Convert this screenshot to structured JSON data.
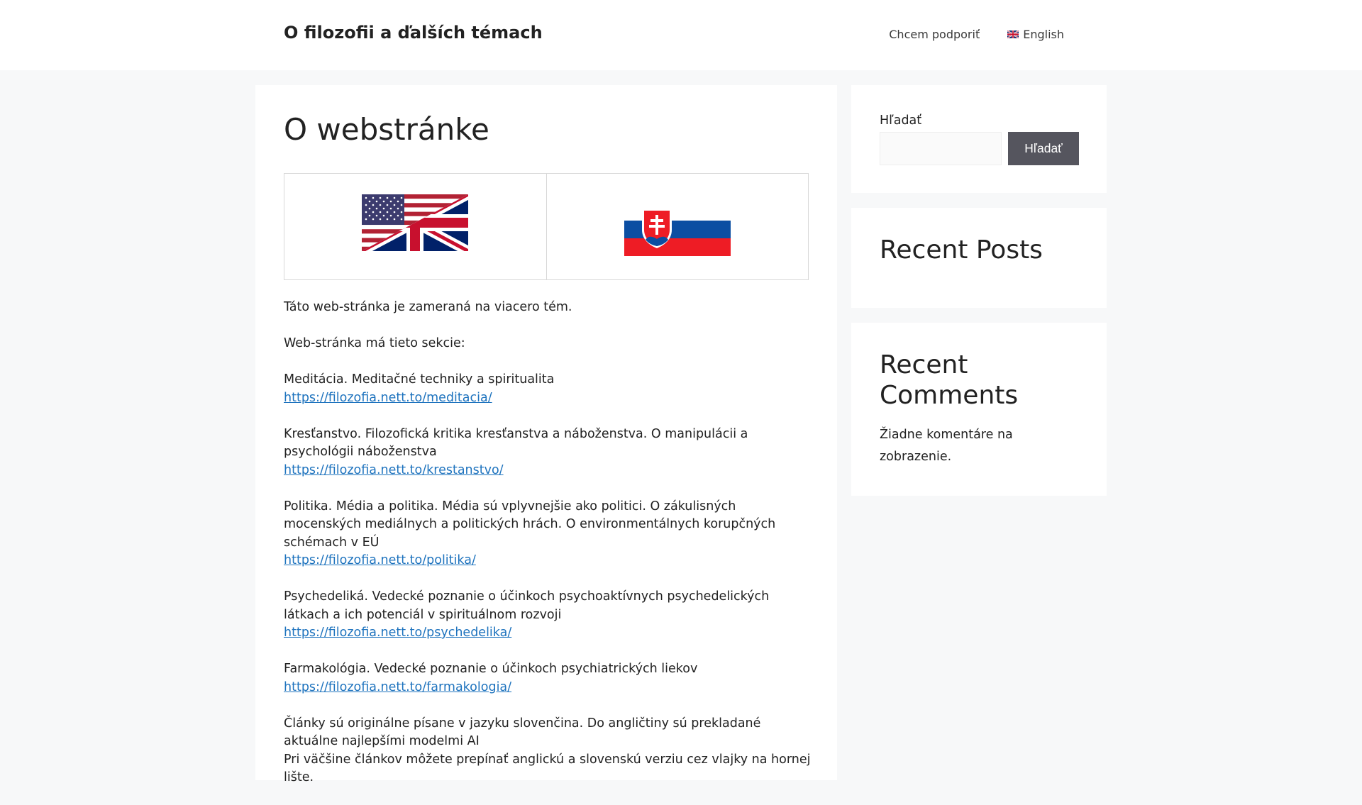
{
  "header": {
    "site_title": "O filozofii a ďalších témach",
    "nav": {
      "support": "Chcem podporiť",
      "language": "English"
    }
  },
  "main": {
    "title": "O webstránke",
    "paragraphs": {
      "p1": "Táto web-stránka je zameraná na viacero tém.",
      "p2": "Web-stránka má tieto sekcie:",
      "s1_text": "Meditácia. Meditačné techniky a spiritualita",
      "s1_link": "https://filozofia.nett.to/meditacia/",
      "s2_text": "Kresťanstvo. Filozofická kritika kresťanstva a náboženstva. O manipulácii a psychológii náboženstva",
      "s2_link": "https://filozofia.nett.to/krestanstvo/",
      "s3_text": "Politika. Média a politika. Média sú vplyvnejšie ako politici. O zákulisných mocenských mediálnych a politických hrách. O environmentálnych korupčných schémach v EÚ",
      "s3_link": "https://filozofia.nett.to/politika/",
      "s4_text": "Psychedeliká. Vedecké poznanie o účinkoch psychoaktívnych psychedelických látkach a ich potenciál v spirituálnom rozvoji",
      "s4_link": "https://filozofia.nett.to/psychedelika/",
      "s5_text": "Farmakológia. Vedecké poznanie o účinkoch psychiatrických liekov",
      "s5_link": "https://filozofia.nett.to/farmakologia/",
      "p_last1": "Články sú originálne písane v jazyku slovenčina. Do angličtiny sú prekladané aktuálne najlepšími modelmi AI",
      "p_last2": "Pri väčšine článkov môžete prepínať anglickú a slovenskú verziu cez vlajky na hornej lište."
    }
  },
  "sidebar": {
    "search": {
      "label": "Hľadať",
      "button": "Hľadať",
      "value": ""
    },
    "recent_posts": {
      "title": "Recent Posts"
    },
    "recent_comments": {
      "title": "Recent Comments",
      "empty_text": "Žiadne komentáre na zobrazenie."
    }
  },
  "icons": {
    "flags": [
      "us-uk-flag-icon",
      "slovak-flag-icon",
      "uk-flag-icon"
    ]
  },
  "colors": {
    "link": "#1e73be",
    "button_bg": "#55555e",
    "page_bg": "#f7f8f9"
  }
}
